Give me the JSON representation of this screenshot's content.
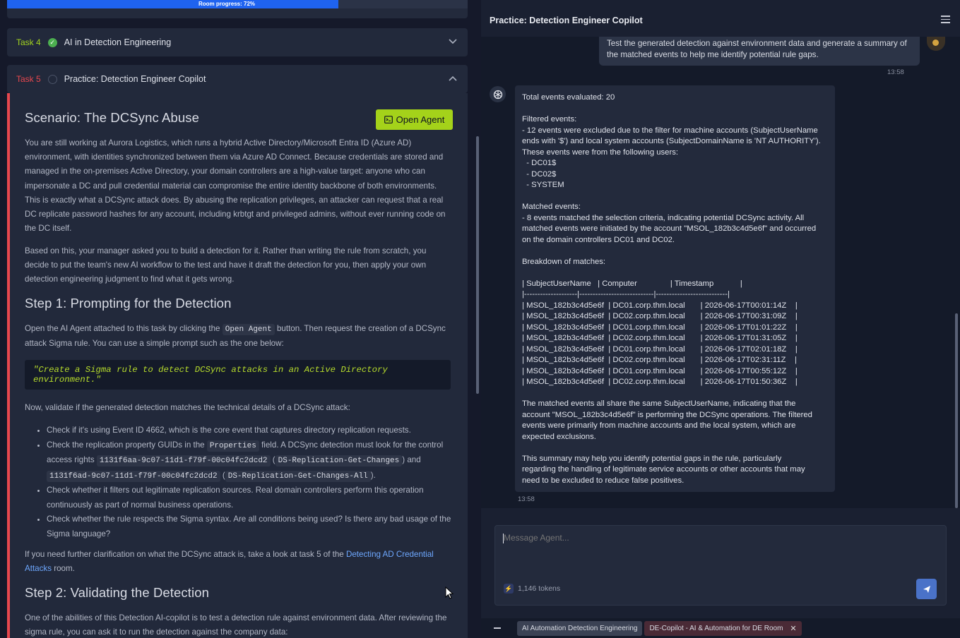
{
  "left": {
    "progress": {
      "label": "Room progress: 72%",
      "percent": 72
    },
    "tasks": [
      {
        "number": "Task 4",
        "title": "AI in Detection Engineering",
        "status": "done"
      },
      {
        "number": "Task 5",
        "title": "Practice: Detection Engineer Copilot",
        "status": "current"
      }
    ],
    "open_agent_label": "Open Agent",
    "scenario_title": "Scenario: The DCSync Abuse",
    "para1": "You are still working at Aurora Logistics, which runs a hybrid Active Directory/Microsoft Entra ID (Azure AD) environment, with identities synchronized between them via Azure AD Connect. Because credentials are stored and managed in the on-premises Active Directory, your domain controllers are a high-value target: anyone who can impersonate a DC and pull credential material can compromise the entire identity backbone of both environments. This is exactly what a DCSync attack does. By abusing the replication privileges, an attacker can request that a real DC replicate password hashes for any account, including krbtgt and privileged admins, without ever running code on the DC itself.",
    "para2": "Based on this, your manager asked you to build a detection for it. Rather than writing the rule from scratch, you decide to put the team's new AI workflow to the test and have it draft the detection for you, then apply your own detection engineering judgment to find what it gets wrong.",
    "step1_title": "Step 1: Prompting for the Detection",
    "step1_p_a": "Open the AI Agent attached to this task by clicking the ",
    "step1_p_code": "Open Agent",
    "step1_p_b": " button. Then request the creation of a DCSync attack Sigma rule. You can use a simple prompt such as the one below:",
    "prompt_quote": "\"Create a Sigma rule to detect DCSync attacks in an Active Directory environment.\"",
    "validate_intro": "Now, validate if the generated detection matches the technical details of a DCSync attack:",
    "check1": "Check if it's using Event ID 4662, which is the core event that captures directory replication requests.",
    "check2_a": "Check the replication property GUIDs in the ",
    "check2_code1": "Properties",
    "check2_b": " field. A DCSync detection must look for the control access rights ",
    "check2_code2": "1131f6aa-9c07-11d1-f79f-00c04fc2dcd2",
    "check2_code3": "DS-Replication-Get-Changes",
    "check2_c": " and ",
    "check2_code4": "1131f6ad-9c07-11d1-f79f-00c04fc2dcd2",
    "check2_code5": "DS-Replication-Get-Changes-All",
    "check3": "Check whether it filters out legitimate replication sources. Real domain controllers perform this operation continuously as part of normal business operations.",
    "check4": "Check whether the rule respects the Sigma syntax. Are all conditions being used? Is there any bad usage of the Sigma language?",
    "further_a": "If you need further clarification on what the DCSync attack is, take a look at task 5 of the ",
    "further_link": "Detecting AD Credential Attacks",
    "further_b": " room.",
    "step2_title": "Step 2: Validating the Detection",
    "step2_p": "One of the abilities of this Detection AI-copilot is to test a detection rule against environment data. After reviewing the sigma rule, you can ask it to run the detection against the company data:"
  },
  "right": {
    "title": "Practice: Detection Engineer Copilot",
    "user_message": "Test the generated detection against environment data and generate a summary of the matched events to help me identify potential rule gaps.",
    "user_time": "13:58",
    "bot_message": "Total events evaluated: 20\n\nFiltered events:\n- 12 events were excluded due to the filter for machine accounts (SubjectUserName\nends with '$') and local system accounts (SubjectDomainName is 'NT AUTHORITY').\nThese events were from the following users:\n  - DC01$\n  - DC02$\n  - SYSTEM\n\nMatched events:\n- 8 events matched the selection criteria, indicating potential DCSync activity. All\nmatched events were initiated by the account \"MSOL_182b3c4d5e6f\" and occurred\non the domain controllers DC01 and DC02.\n\nBreakdown of matches:\n\n| SubjectUserName   | Computer               | Timestamp            |\n|--------------------|----------------------------|---------------------------|\n| MSOL_182b3c4d5e6f  | DC01.corp.thm.local       | 2026-06-17T00:01:14Z    |\n| MSOL_182b3c4d5e6f  | DC02.corp.thm.local       | 2026-06-17T00:31:09Z    |\n| MSOL_182b3c4d5e6f  | DC01.corp.thm.local       | 2026-06-17T01:01:22Z    |\n| MSOL_182b3c4d5e6f  | DC02.corp.thm.local       | 2026-06-17T01:31:05Z    |\n| MSOL_182b3c4d5e6f  | DC01.corp.thm.local       | 2026-06-17T02:01:18Z    |\n| MSOL_182b3c4d5e6f  | DC02.corp.thm.local       | 2026-06-17T02:31:11Z    |\n| MSOL_182b3c4d5e6f  | DC01.corp.thm.local       | 2026-06-17T00:55:12Z    |\n| MSOL_182b3c4d5e6f  | DC02.corp.thm.local       | 2026-06-17T01:50:36Z    |\n\nThe matched events all share the same SubjectUserName, indicating that the\naccount \"MSOL_182b3c4d5e6f\" is performing the DCSync operations. The filtered\nevents were primarily from machine accounts and the local system, which are\nexpected exclusions.\n\nThis summary may help you identify potential gaps in the rule, particularly\nregarding the handling of legitimate service accounts or other accounts that may\nneed to be excluded to reduce false positives.",
    "bot_time": "13:58",
    "composer_placeholder": "Message Agent...",
    "tokens": "1,146 tokens",
    "chips": [
      {
        "label": "AI Automation Detection Engineering"
      },
      {
        "label": "DE-Copilot - AI & Automation for DE Room"
      }
    ]
  }
}
